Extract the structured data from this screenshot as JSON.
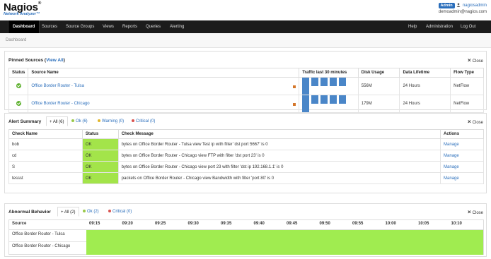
{
  "brand": {
    "name": "Nagios",
    "reg": "®",
    "product": "Network Analyzer",
    "tm": "™"
  },
  "user": {
    "badge": "Admin",
    "username": "nagiosadmin",
    "email": "demoadmin@nagios.com"
  },
  "nav": {
    "left": [
      "Dashboard",
      "Sources",
      "Source Groups",
      "Views",
      "Reports",
      "Queries",
      "Alerting"
    ],
    "right": [
      "Help",
      "Administration",
      "Log Out"
    ]
  },
  "breadcrumb": "Dashboard",
  "close_label": "Close",
  "pinned": {
    "title": "Pinned Sources",
    "view_all": "View All",
    "columns": [
      "Status",
      "Source Name",
      "Traffic last 30 minutes",
      "Disk Usage",
      "Data Lifetime",
      "Flow Type"
    ],
    "rows": [
      {
        "name": "Office Border Router - Tulsa",
        "disk": "556M",
        "lifetime": "24 Hours",
        "flow": "NetFlow"
      },
      {
        "name": "Office Border Router - Chicago",
        "disk": "179M",
        "lifetime": "24 Hours",
        "flow": "NetFlow"
      }
    ]
  },
  "alerts": {
    "title": "Alert Summary",
    "tabs": [
      "+ All (6)",
      "Ok (6)",
      "Warning (0)",
      "Critical (0)"
    ],
    "tab_colors": [
      "#333333",
      "#9ac84a",
      "#e2b62a",
      "#d9534f"
    ],
    "columns": [
      "Check Name",
      "Status",
      "Check Message",
      "Actions"
    ],
    "manage_label": "Manage",
    "rows": [
      {
        "name": "bob",
        "status": "OK",
        "message": "bytes on Office Border Router - Tulsa view Test ip with filter 'dst port 5667' is 0"
      },
      {
        "name": "cd",
        "status": "OK",
        "message": "bytes on Office Border Router - Chicago view FTP with filter 'dst port 23' is 0"
      },
      {
        "name": "S",
        "status": "OK",
        "message": "bytes on Office Border Router - Chicago view port 23 with filter 'dst ip 192.168.1.1' is 0"
      },
      {
        "name": "tessst",
        "status": "OK",
        "message": "packets on Office Border Router - Chicago view Bandwidth with filter 'port 80' is 0"
      }
    ]
  },
  "abnormal": {
    "title": "Abnormal Behavior",
    "tabs": [
      "+ All (2)",
      "Ok (2)",
      "Critical (0)"
    ],
    "tab_colors": [
      "#333333",
      "#9ac84a",
      "#d9534f"
    ],
    "source_header": "Source",
    "times": [
      "09:15",
      "09:20",
      "09:25",
      "09:30",
      "09:35",
      "09:40",
      "09:45",
      "09:50",
      "09:55",
      "10:00",
      "10:05",
      "10:10"
    ],
    "sources": [
      "Office Border Router - Tulsa",
      "Office Border Router - Chicago"
    ],
    "bar_color": "#a0ec50"
  }
}
